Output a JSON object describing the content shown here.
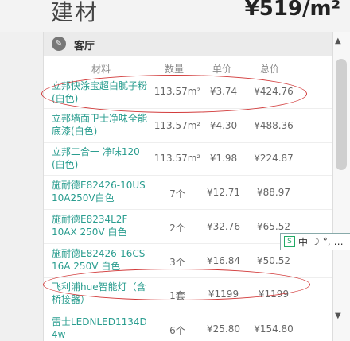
{
  "header": {
    "title": "建材",
    "price": "¥519/m²"
  },
  "room": {
    "name": "客厅",
    "icon": "broom-icon"
  },
  "columns": {
    "material": "材料",
    "qty": "数量",
    "unit_price": "单价",
    "total": "总价"
  },
  "rows": [
    {
      "name": "立邦快涂宝超白腻子粉(白色)",
      "qty": "113.57m²",
      "unit": "¥3.74",
      "total": "¥424.76"
    },
    {
      "name": "立邦墙面卫士净味全能底漆(白色)",
      "qty": "113.57m²",
      "unit": "¥4.30",
      "total": "¥488.36"
    },
    {
      "name": "立邦二合一 净味120 (白色)",
      "qty": "113.57m²",
      "unit": "¥1.98",
      "total": "¥224.87"
    },
    {
      "name": "施耐德E82426-10US 10A250V白色",
      "qty": "7个",
      "unit": "¥12.71",
      "total": "¥88.97"
    },
    {
      "name": "施耐德E8234L2F 10AX 250V 白色",
      "qty": "2个",
      "unit": "¥32.76",
      "total": "¥65.52"
    },
    {
      "name": "施耐德E82426-16CS 16A 250V 白色",
      "qty": "3个",
      "unit": "¥16.84",
      "total": "¥50.52"
    },
    {
      "name": "飞利浦hue智能灯（含桥接器）",
      "qty": "1套",
      "unit": "¥1199",
      "total": "¥1199"
    },
    {
      "name": "雷士LEDNLED1134D 4w",
      "qty": "6个",
      "unit": "¥25.80",
      "total": "¥154.80"
    }
  ],
  "ime": {
    "mode": "中",
    "logo": "S"
  }
}
